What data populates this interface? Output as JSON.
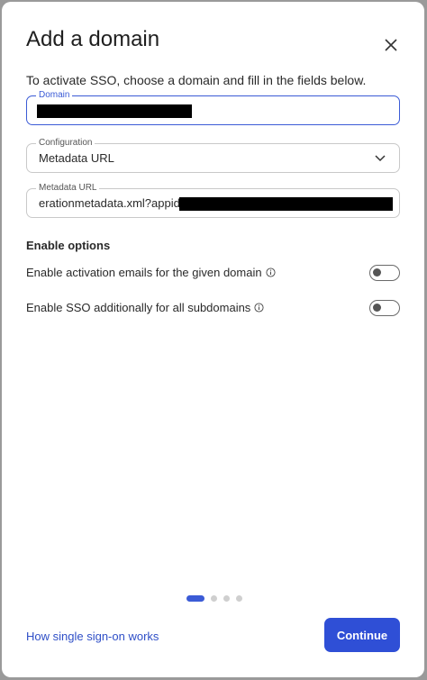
{
  "dialog": {
    "title": "Add a domain",
    "intro": "To activate SSO, choose a domain and fill in the fields below."
  },
  "fields": {
    "domain": {
      "label": "Domain",
      "value": ""
    },
    "configuration": {
      "label": "Configuration",
      "value": "Metadata URL"
    },
    "metadata_url": {
      "label": "Metadata URL",
      "value": "erationmetadata.xml?appid="
    }
  },
  "options": {
    "heading": "Enable options",
    "items": [
      {
        "label": "Enable activation emails for the given domain",
        "enabled": false
      },
      {
        "label": "Enable SSO additionally for all subdomains",
        "enabled": false
      }
    ]
  },
  "pager": {
    "total": 4,
    "current": 1
  },
  "footer": {
    "help_link": "How single sign-on works",
    "continue_label": "Continue"
  },
  "colors": {
    "accent": "#2f4fd6",
    "focus": "#3b5bd6",
    "link": "#2f4fc7"
  },
  "icons": {
    "close": "close-icon",
    "chevron": "chevron-down-icon",
    "info": "info-icon"
  }
}
